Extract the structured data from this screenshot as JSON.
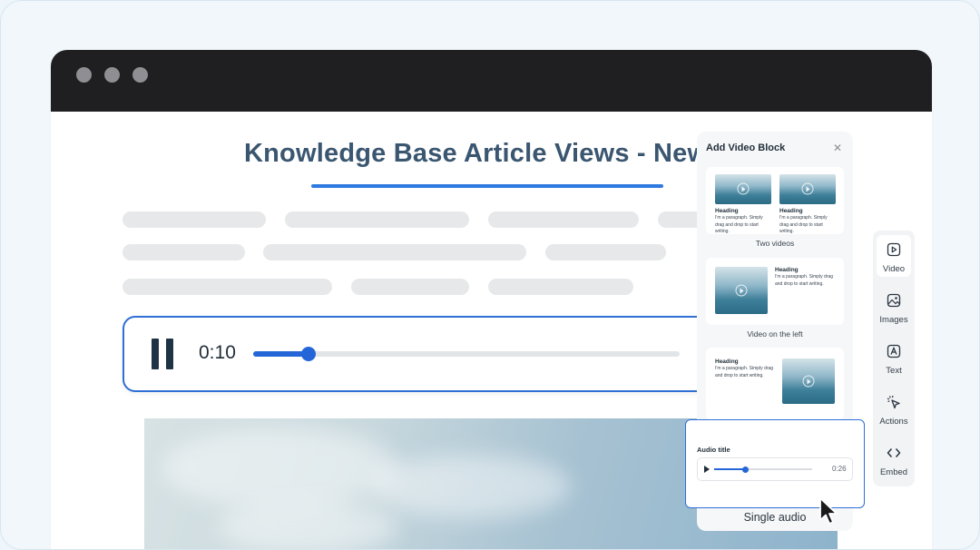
{
  "article": {
    "title": "Knowledge Base Article Views - New"
  },
  "audio_player": {
    "time": "0:10",
    "progress": 0.13,
    "state": "playing",
    "control_icon": "pause-icon"
  },
  "video_panel": {
    "title": "Add Video Block",
    "close_icon": "close-icon",
    "layouts": [
      {
        "caption": "Two videos",
        "items": [
          {
            "heading": "Heading",
            "paragraph": "I'm a paragraph. Simply drag and drop to start writing."
          },
          {
            "heading": "Heading",
            "paragraph": "I'm a paragraph. Simply drag and drop to start writing."
          }
        ]
      },
      {
        "caption": "Video on the left",
        "heading": "Heading",
        "paragraph": "I'm a paragraph. Simply drag and drop to start writing."
      },
      {
        "caption": "",
        "heading": "Heading",
        "paragraph": "I'm a paragraph. Simply drag and drop to start writing."
      }
    ]
  },
  "audio_block": {
    "title": "Audio title",
    "duration": "0:26",
    "progress": 0.32,
    "caption": "Single audio"
  },
  "sidebar": {
    "items": [
      {
        "label": "Video",
        "icon": "video-icon",
        "active": true
      },
      {
        "label": "Images",
        "icon": "image-icon",
        "active": false
      },
      {
        "label": "Text",
        "icon": "text-icon",
        "active": false
      },
      {
        "label": "Actions",
        "icon": "cursor-click-icon",
        "active": false
      },
      {
        "label": "Embed",
        "icon": "code-icon",
        "active": false
      }
    ]
  },
  "colors": {
    "accent": "#2f6fd6",
    "title_text": "#3a5670",
    "titlebar": "#1f1f22"
  }
}
